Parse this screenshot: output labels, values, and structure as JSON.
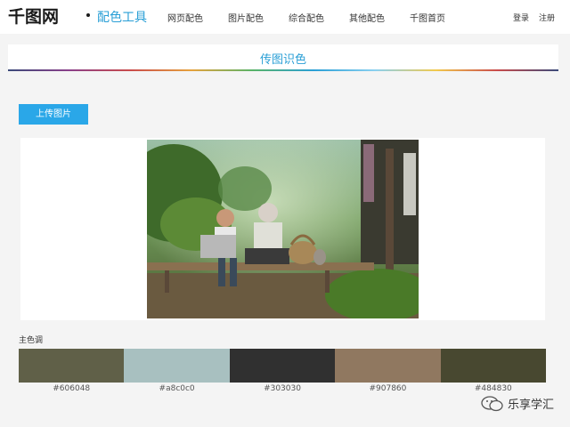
{
  "header": {
    "logo": "千图网",
    "subbrand": "配色工具",
    "nav": [
      "网页配色",
      "图片配色",
      "综合配色",
      "其他配色",
      "千图首页"
    ],
    "login": "登录",
    "register": "注册"
  },
  "page": {
    "title": "传图识色",
    "upload_label": "上传图片",
    "palette_label": "主色调"
  },
  "palette": [
    {
      "color": "#606048",
      "code": "#606048"
    },
    {
      "color": "#a8c0c0",
      "code": "#a8c0c0"
    },
    {
      "color": "#303030",
      "code": "#303030"
    },
    {
      "color": "#907860",
      "code": "#907860"
    },
    {
      "color": "#484830",
      "code": "#484830"
    }
  ],
  "icons": {
    "photo": "uploaded-photo-icon",
    "watermark": "wechat-icon"
  },
  "watermark": {
    "text": "乐享学汇"
  }
}
